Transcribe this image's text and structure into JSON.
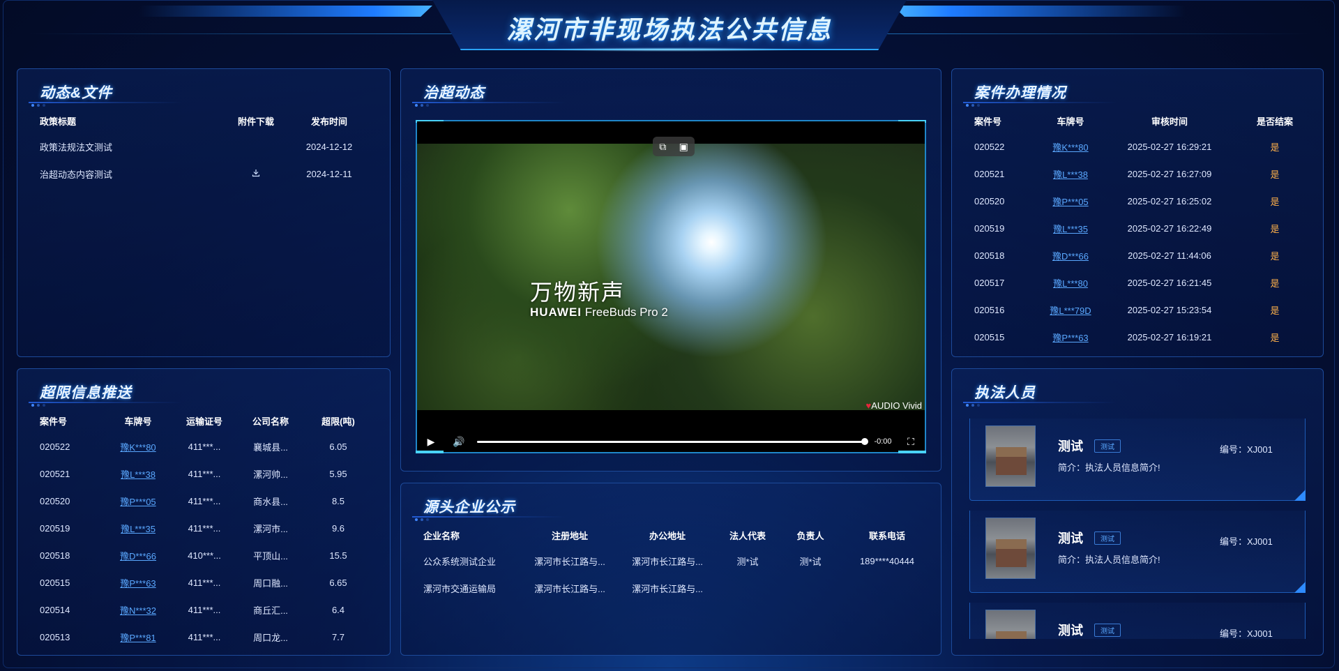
{
  "title": "漯河市非现场执法公共信息",
  "policy": {
    "title": "动态&文件",
    "columns": [
      "政策标题",
      "附件下载",
      "发布时间"
    ],
    "rows": [
      {
        "title": "政策法规法文测试",
        "attachment": "",
        "date": "2024-12-12"
      },
      {
        "title": "治超动态内容测试",
        "attachment": "download-icon",
        "date": "2024-12-11"
      }
    ]
  },
  "overload": {
    "title": "超限信息推送",
    "columns": [
      "案件号",
      "车牌号",
      "运输证号",
      "公司名称",
      "超限(吨)"
    ],
    "rows": [
      {
        "case": "020522",
        "plate": "豫K***80",
        "permit": "411***...",
        "company": "襄城县...",
        "over": "6.05"
      },
      {
        "case": "020521",
        "plate": "豫L***38",
        "permit": "411***...",
        "company": "漯河帅...",
        "over": "5.95"
      },
      {
        "case": "020520",
        "plate": "豫P***05",
        "permit": "411***...",
        "company": "商水县...",
        "over": "8.5"
      },
      {
        "case": "020519",
        "plate": "豫L***35",
        "permit": "411***...",
        "company": "漯河市...",
        "over": "9.6"
      },
      {
        "case": "020518",
        "plate": "豫D***66",
        "permit": "410***...",
        "company": "平顶山...",
        "over": "15.5"
      },
      {
        "case": "020515",
        "plate": "豫P***63",
        "permit": "411***...",
        "company": "周口融...",
        "over": "6.65"
      },
      {
        "case": "020514",
        "plate": "豫N***32",
        "permit": "411***...",
        "company": "商丘汇...",
        "over": "6.4"
      },
      {
        "case": "020513",
        "plate": "豫P***81",
        "permit": "411***...",
        "company": "周口龙...",
        "over": "7.7"
      }
    ]
  },
  "dynamics": {
    "title": "治超动态",
    "video": {
      "slogan": "万物新声",
      "brand_bold": "HUAWEI",
      "brand_rest": " FreeBuds Pro 2",
      "watermark": "AUDIO Vivid",
      "time": "-0:00",
      "progress": 1.0
    }
  },
  "enterprise": {
    "title": "源头企业公示",
    "columns": [
      "企业名称",
      "注册地址",
      "办公地址",
      "法人代表",
      "负责人",
      "联系电话"
    ],
    "rows": [
      {
        "name": "公众系统测试企业",
        "reg": "漯河市长江路与...",
        "office": "漯河市长江路与...",
        "legal": "测*试",
        "owner": "测*试",
        "phone": "189****40444"
      },
      {
        "name": "漯河市交通运输局",
        "reg": "漯河市长江路与...",
        "office": "漯河市长江路与...",
        "legal": "",
        "owner": "",
        "phone": ""
      }
    ]
  },
  "cases": {
    "title": "案件办理情况",
    "columns": [
      "案件号",
      "车牌号",
      "审核时间",
      "是否结案"
    ],
    "rows": [
      {
        "case": "020522",
        "plate": "豫K***80",
        "time": "2025-02-27 16:29:21",
        "closed": "是"
      },
      {
        "case": "020521",
        "plate": "豫L***38",
        "time": "2025-02-27 16:27:09",
        "closed": "是"
      },
      {
        "case": "020520",
        "plate": "豫P***05",
        "time": "2025-02-27 16:25:02",
        "closed": "是"
      },
      {
        "case": "020519",
        "plate": "豫L***35",
        "time": "2025-02-27 16:22:49",
        "closed": "是"
      },
      {
        "case": "020518",
        "plate": "豫D***66",
        "time": "2025-02-27 11:44:06",
        "closed": "是"
      },
      {
        "case": "020517",
        "plate": "豫L***80",
        "time": "2025-02-27 16:21:45",
        "closed": "是"
      },
      {
        "case": "020516",
        "plate": "豫L***79D",
        "time": "2025-02-27 15:23:54",
        "closed": "是"
      },
      {
        "case": "020515",
        "plate": "豫P***63",
        "time": "2025-02-27 16:19:21",
        "closed": "是"
      }
    ]
  },
  "officers": {
    "title": "执法人员",
    "items": [
      {
        "name": "测试",
        "tag": "测试",
        "bio": "简介：执法人员信息简介!",
        "code": "编号：XJ001"
      },
      {
        "name": "测试",
        "tag": "测试",
        "bio": "简介：执法人员信息简介!",
        "code": "编号：XJ001"
      },
      {
        "name": "测试",
        "tag": "测试",
        "bio": "",
        "code": "编号：XJ001"
      }
    ]
  },
  "colors": {
    "accent": "#2a9dff",
    "link": "#5aa8ff",
    "yes": "#ffb14a"
  }
}
